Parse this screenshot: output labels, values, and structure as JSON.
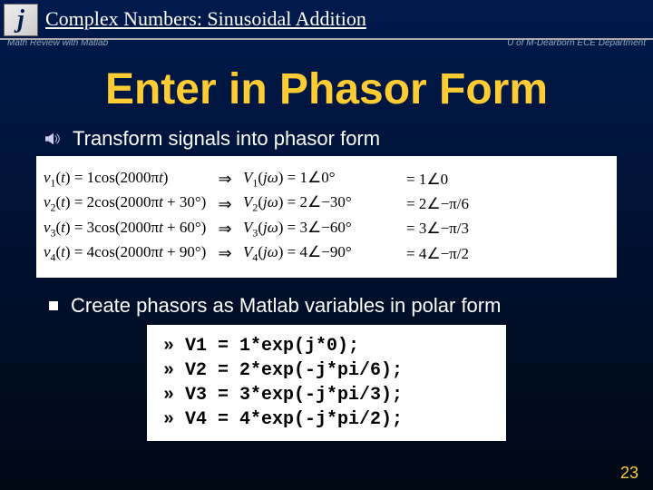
{
  "header": {
    "icon_letter": "j",
    "breadcrumb": "Complex Numbers: Sinusoidal Addition",
    "subtitle_left": "Math Review with Matlab",
    "subtitle_right": "U of M-Dearborn ECE Department"
  },
  "title": "Enter in Phasor Form",
  "bullet1": "Transform signals into phasor form",
  "bullet2": "Create phasors as Matlab variables in polar form",
  "math": {
    "rows": [
      {
        "lhs": "v₁(t) = 1cos(2000πt)",
        "mid": "V₁(jω) = 1∠0°",
        "rhs": "= 1∠0"
      },
      {
        "lhs": "v₂(t) = 2cos(2000πt + 30°)",
        "mid": "V₂(jω) = 2∠−30°",
        "rhs": "= 2∠−π/6"
      },
      {
        "lhs": "v₃(t) = 3cos(2000πt + 60°)",
        "mid": "V₃(jω) = 3∠−60°",
        "rhs": "= 3∠−π/3"
      },
      {
        "lhs": "v₄(t) = 4cos(2000πt + 90°)",
        "mid": "V₄(jω) = 4∠−90°",
        "rhs": "= 4∠−π/2"
      }
    ]
  },
  "code": {
    "lines": [
      "» V1 = 1*exp(j*0);",
      "» V2 = 2*exp(-j*pi/6);",
      "» V3 = 3*exp(-j*pi/3);",
      "» V4 = 4*exp(-j*pi/2);"
    ]
  },
  "page_number": "23"
}
